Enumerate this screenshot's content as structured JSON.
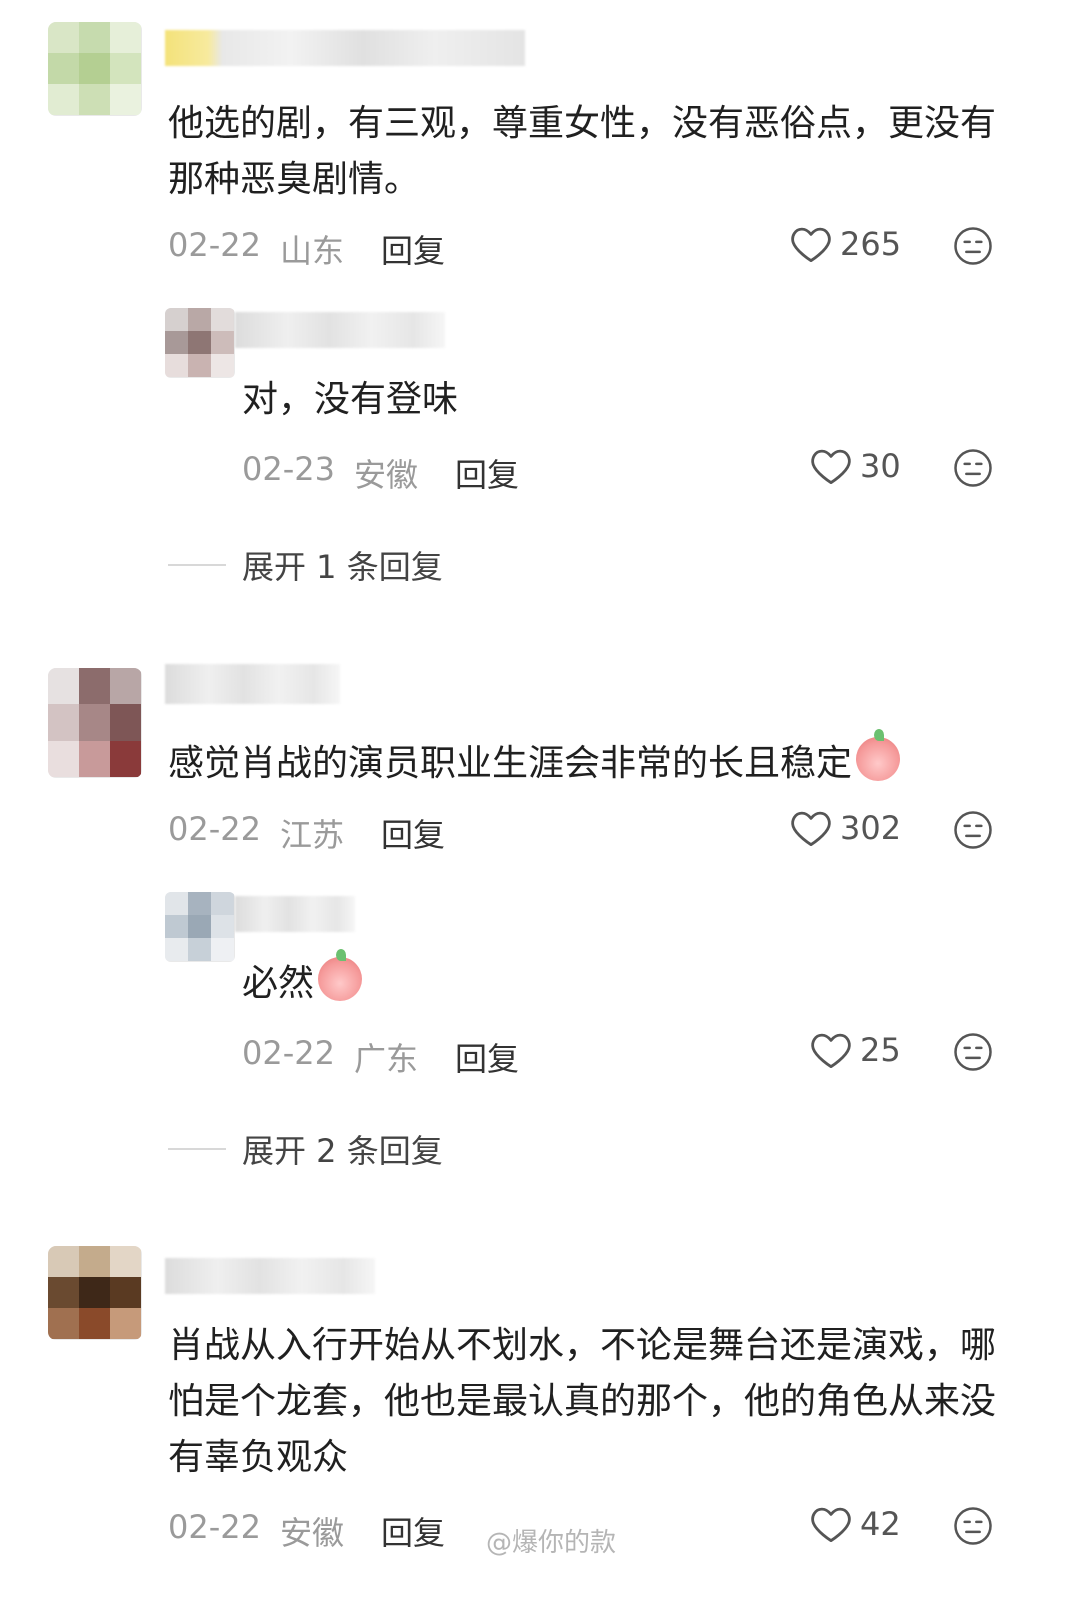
{
  "comments": [
    {
      "text": "他选的剧，有三观，尊重女性，没有恶俗点，更没有那种恶臭剧情。",
      "date": "02-22",
      "location": "山东",
      "reply_label": "回复",
      "likes": "265",
      "replies": [
        {
          "text": "对，没有登味",
          "date": "02-23",
          "location": "安徽",
          "reply_label": "回复",
          "likes": "30"
        }
      ],
      "expand_label": "展开 1 条回复"
    },
    {
      "text": "感觉肖战的演员职业生涯会非常的长且稳定",
      "emoji": "pleading-face-emoji",
      "date": "02-22",
      "location": "江苏",
      "reply_label": "回复",
      "likes": "302",
      "replies": [
        {
          "text": "必然",
          "emoji": "heart-eyes-emoji",
          "date": "02-22",
          "location": "广东",
          "reply_label": "回复",
          "likes": "25"
        }
      ],
      "expand_label": "展开 2 条回复"
    },
    {
      "text": "肖战从入行开始从不划水，不论是舞台还是演戏，哪怕是个龙套，他也是最认真的那个，他的角色从来没有辜负观众",
      "date": "02-22",
      "location": "安徽",
      "reply_label": "回复",
      "likes": "42"
    }
  ],
  "watermark": "@爆你的款",
  "icons": {
    "like": "heart-outline-icon",
    "dislike": "neutral-face-icon"
  },
  "colors": {
    "text": "#202020",
    "meta": "#9a9a9a",
    "icon": "#555555"
  }
}
